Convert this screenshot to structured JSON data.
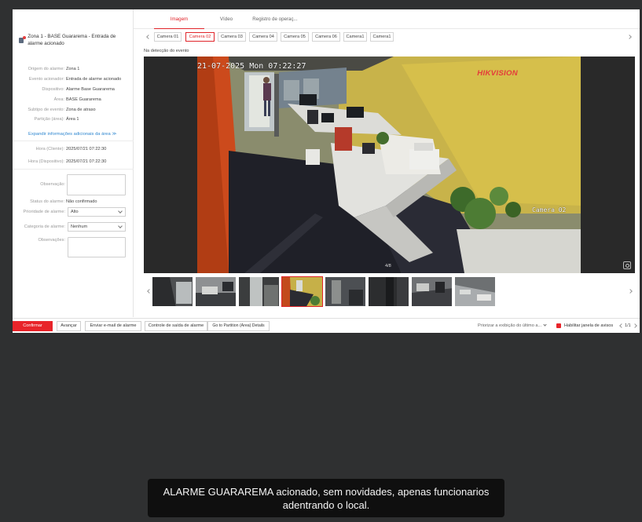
{
  "alarm": {
    "title": "Zona 1 - BASE Guararema - Entrada de alarme acionado"
  },
  "details": [
    {
      "label": "Origem do alarme:",
      "value": "Zona 1"
    },
    {
      "label": "Evento acionador:",
      "value": "Entrada de alarme acionado"
    },
    {
      "label": "Dispositivo:",
      "value": "Alarme Base Guararema"
    },
    {
      "label": "Área:",
      "value": "BASE Guararema"
    },
    {
      "label": "Subtipo de evento:",
      "value": "Zona de atraso"
    },
    {
      "label": "Partição (área):",
      "value": "Área 1"
    }
  ],
  "expand_link": "Expandir informações adicionais da área ≫",
  "times": [
    {
      "label": "Hora (Cliente):",
      "value": "2025/07/21 07:22:30"
    },
    {
      "label": "Hora (Dispositivo):",
      "value": "2025/07/21 07:22:30"
    }
  ],
  "form": {
    "observation_label": "Observação:",
    "status_label": "Status do alarme:",
    "status_value": "Não confirmado",
    "priority_label": "Prioridade de alarme:",
    "priority_value": "Alto",
    "category_label": "Categoria de alarme:",
    "category_value": "Nenhum",
    "notes_label": "Observações:"
  },
  "main_tabs": [
    "Imagem",
    "Vídeo",
    "Registro de operaç..."
  ],
  "camera_tabs": [
    "Camera 01",
    "Camera 02",
    "Camera 03",
    "Camera 04",
    "Camera 05",
    "Camera 06",
    "Camera1",
    "Camera1"
  ],
  "active_camera": 1,
  "detect_label": "Na detecção do evento",
  "video": {
    "timestamp": "21-07-2025 Mon 07:22:27",
    "brand": "HIKVISION",
    "camera_label": "Camera 02",
    "page_indicator": "4/8"
  },
  "thumb_count": 8,
  "active_thumb": 3,
  "bottom": {
    "confirm": "Confirmar",
    "advance": "Avançar",
    "email": "Enviar e-mail de alarme",
    "output": "Controle de saída de alarme",
    "partition": "Go to Partition (Area) Details",
    "prioritize": "Priorizar a exibição do último a...",
    "enable_popup": "Habilitar janela de avisos",
    "page_count": "1/1"
  },
  "subtitle": "ALARME GUARAREMA acionado, sem novidades, apenas funcionarios adentrando o local.",
  "colors": {
    "accent": "#e8242a",
    "link": "#2f87d0",
    "backdrop": "#2f3031"
  }
}
